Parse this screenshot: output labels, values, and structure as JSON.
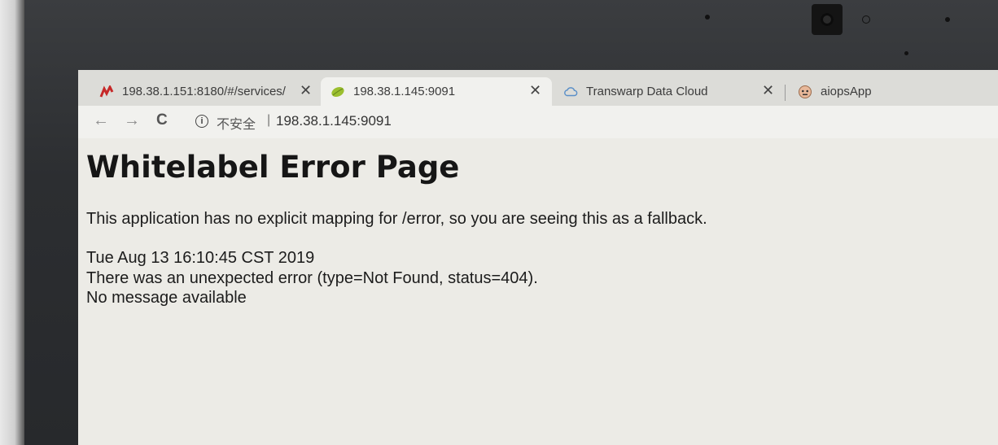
{
  "browser": {
    "tabs": [
      {
        "title": "198.38.1.151:8180/#/services/",
        "icon": "chart-bars-icon",
        "close": "✕"
      },
      {
        "title": "198.38.1.145:9091",
        "icon": "spring-leaf-icon",
        "close": "✕",
        "active": true
      },
      {
        "title": "Transwarp Data Cloud",
        "icon": "cloud-icon",
        "close": "✕"
      },
      {
        "title": "aiopsApp",
        "icon": "robot-face-icon",
        "close": ""
      }
    ],
    "toolbar": {
      "back": "←",
      "forward": "→",
      "reload": "C",
      "security_label": "不安全",
      "separator": "|",
      "url": "198.38.1.145:9091"
    }
  },
  "page": {
    "title": "Whitelabel Error Page",
    "message": "This application has no explicit mapping for /error, so you are seeing this as a fallback.",
    "timestamp": "Tue Aug 13 16:10:45 CST 2019",
    "error": "There was an unexpected error (type=Not Found, status=404).",
    "detail": "No message available"
  }
}
